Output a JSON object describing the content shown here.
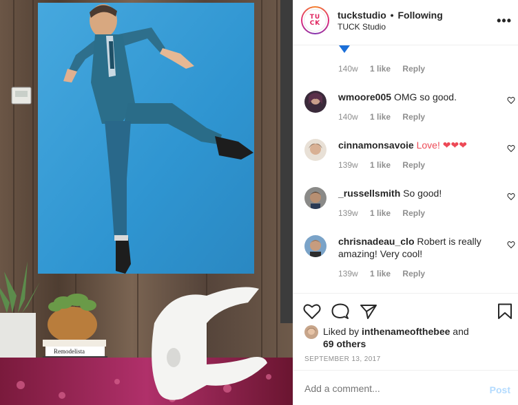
{
  "post": {
    "username": "tuckstudio",
    "dot": "•",
    "follow_status": "Following",
    "location": "TUCK Studio",
    "more": "•••",
    "avatar_logo_top": "TU",
    "avatar_logo_bottom": "CK"
  },
  "caption_meta": {
    "time": "140w",
    "likes": "1 like",
    "reply": "Reply"
  },
  "comments": [
    {
      "user": "wmoore005",
      "text": "OMG so good.",
      "time": "140w",
      "likes": "1 like",
      "reply": "Reply"
    },
    {
      "user": "cinnamonsavoie",
      "text": "Love! ❤❤❤",
      "time": "139w",
      "likes": "1 like",
      "reply": "Reply"
    },
    {
      "user": "_russellsmith",
      "text": "So good!",
      "time": "139w",
      "likes": "1 like",
      "reply": "Reply"
    },
    {
      "user": "chrisnadeau_clo",
      "text": "Robert is really amazing! Very cool!",
      "time": "139w",
      "likes": "1 like",
      "reply": "Reply"
    }
  ],
  "likes": {
    "prefix": "Liked by",
    "user": "inthenameofthebee",
    "and": "and",
    "others": "69 others"
  },
  "date": "SEPTEMBER 13, 2017",
  "add_comment": {
    "placeholder": "Add a comment...",
    "post_label": "Post"
  },
  "photo": {
    "book_title": "Remodelista"
  },
  "colors": {
    "accent": "#0095f6",
    "post_disabled": "#b3dbff",
    "muted": "#8e8e8e",
    "heart_red": "#ed4956"
  }
}
